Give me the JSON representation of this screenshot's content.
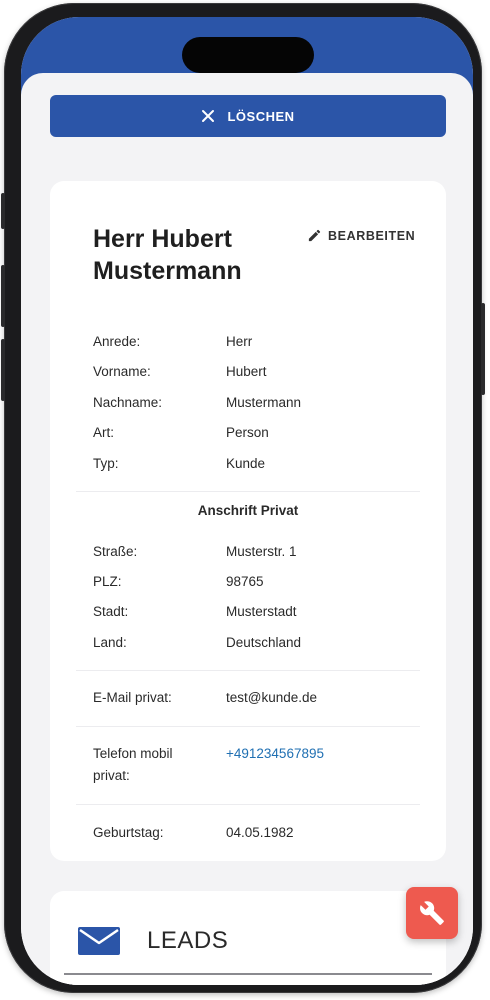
{
  "colors": {
    "primary": "#2b55a8",
    "fab": "#ee5a4f",
    "link": "#1f6fb2",
    "background": "#f3f3f5"
  },
  "actions": {
    "delete_label": "LÖSCHEN",
    "delete_icon": "close-icon",
    "edit_label": "BEARBEITEN",
    "edit_icon": "pencil-icon",
    "fab_icon": "wrench-icon"
  },
  "contact": {
    "name": "Herr Hubert Mustermann",
    "basic": [
      {
        "label": "Anrede:",
        "value": "Herr"
      },
      {
        "label": "Vorname:",
        "value": "Hubert"
      },
      {
        "label": "Nachname:",
        "value": "Mustermann"
      },
      {
        "label": "Art:",
        "value": "Person"
      },
      {
        "label": "Typ:",
        "value": "Kunde"
      }
    ],
    "address_title": "Anschrift Privat",
    "address": [
      {
        "label": "Straße:",
        "value": "Musterstr. 1"
      },
      {
        "label": "PLZ:",
        "value": "98765"
      },
      {
        "label": "Stadt:",
        "value": "Musterstadt"
      },
      {
        "label": "Land:",
        "value": "Deutschland"
      }
    ],
    "email": {
      "label": "E-Mail privat:",
      "value": "test@kunde.de"
    },
    "phone": {
      "label": "Telefon mobil privat:",
      "value": "+491234567895"
    },
    "birthday": {
      "label": "Geburtstag:",
      "value": "04.05.1982"
    }
  },
  "leads": {
    "label": "LEADS",
    "icon": "mail-icon"
  }
}
